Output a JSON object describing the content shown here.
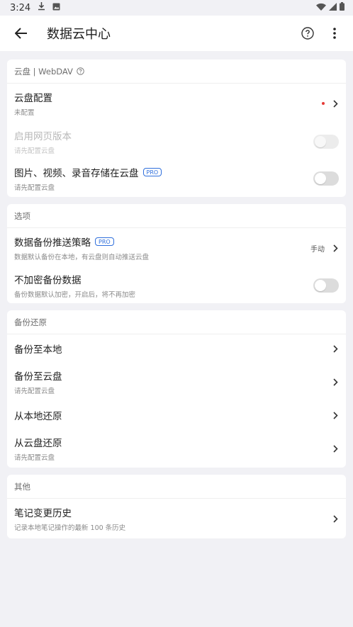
{
  "status_bar": {
    "time": "3:24"
  },
  "app_bar": {
    "title": "数据云中心"
  },
  "sections": {
    "cloud": {
      "header": "云盘 | WebDAV",
      "config": {
        "title": "云盘配置",
        "sub": "未配置"
      },
      "web": {
        "title": "启用网页版本",
        "sub": "请先配置云盘"
      },
      "media": {
        "title": "图片、视频、录音存储在云盘",
        "badge": "PRO",
        "sub": "请先配置云盘"
      }
    },
    "options": {
      "header": "选项",
      "push": {
        "title": "数据备份推送策略",
        "badge": "PRO",
        "sub": "数据默认备份在本地，有云盘则自动推送云盘",
        "value": "手动"
      },
      "encrypt": {
        "title": "不加密备份数据",
        "sub": "备份数据默认加密，开启后，将不再加密"
      }
    },
    "backup": {
      "header": "备份还原",
      "to_local": {
        "title": "备份至本地"
      },
      "to_cloud": {
        "title": "备份至云盘",
        "sub": "请先配置云盘"
      },
      "from_local": {
        "title": "从本地还原"
      },
      "from_cloud": {
        "title": "从云盘还原",
        "sub": "请先配置云盘"
      }
    },
    "other": {
      "header": "其他",
      "history": {
        "title": "笔记变更历史",
        "sub": "记录本地笔记操作的最新 100 条历史"
      }
    }
  },
  "icons": {
    "back": "arrow-left-icon",
    "help": "question-circle-icon",
    "more": "more-vert-icon",
    "chevron": "chevron-right-icon",
    "download": "download-icon",
    "image": "image-icon",
    "wifi": "wifi-icon",
    "signal": "signal-icon",
    "battery": "battery-icon"
  },
  "colors": {
    "accent": "#2f6fdc",
    "dot": "#e53935",
    "background": "#f1f1f5"
  }
}
